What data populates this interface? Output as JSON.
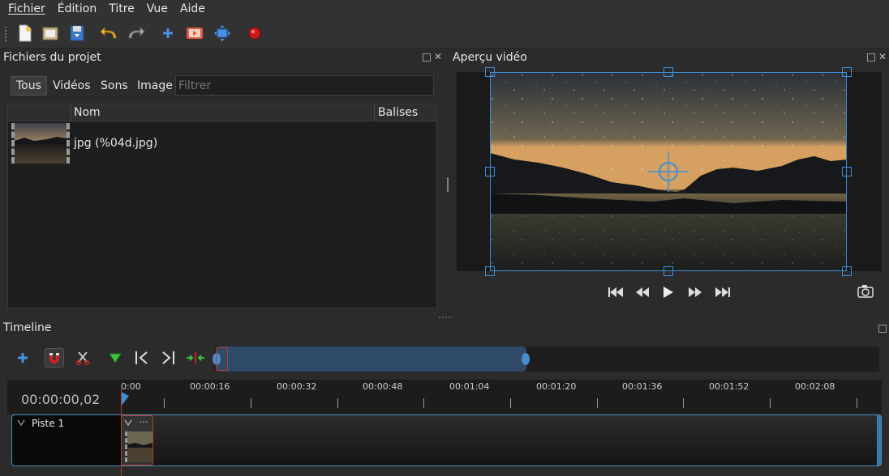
{
  "menu": [
    "Fichier",
    "Édition",
    "Titre",
    "Vue",
    "Aide"
  ],
  "project_files": {
    "title": "Fichiers du projet",
    "filters": [
      "Tous",
      "Vidéos",
      "Sons",
      "Image"
    ],
    "filter_placeholder": "Filtrer",
    "columns": [
      "Nom",
      "Balises"
    ],
    "items": [
      {
        "name": "jpg (%04d.jpg)"
      }
    ]
  },
  "preview": {
    "title": "Aperçu vidéo"
  },
  "timeline": {
    "title": "Timeline",
    "timecode": "00:00:00,02",
    "ruler_labels": [
      "0:00",
      "00:00:16",
      "00:00:32",
      "00:00:48",
      "00:01:04",
      "00:01:20",
      "00:01:36",
      "00:01:52",
      "00:02:08"
    ],
    "tracks": [
      {
        "name": "Piste 1"
      }
    ],
    "clip_menu": "..."
  },
  "colors": {
    "accent": "#3f8fd8",
    "playhead": "#c0392b",
    "zoom_range": "#2f4a66"
  }
}
